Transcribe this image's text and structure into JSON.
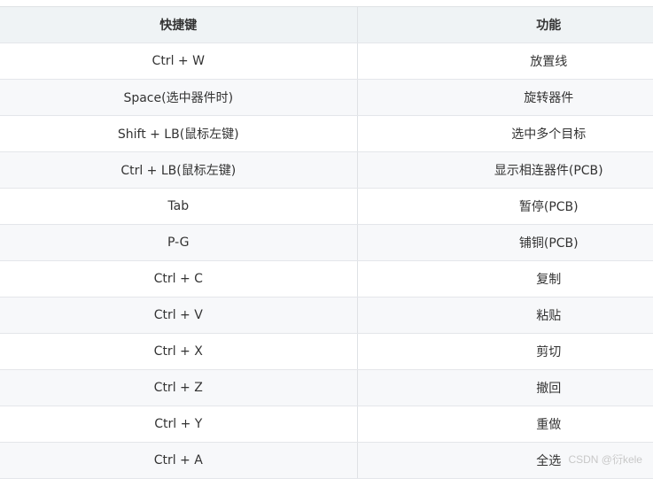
{
  "table": {
    "headers": [
      "快捷键",
      "功能"
    ],
    "rows": [
      [
        "Ctrl + W",
        "放置线"
      ],
      [
        "Space(选中器件时)",
        "旋转器件"
      ],
      [
        "Shift + LB(鼠标左键)",
        "选中多个目标"
      ],
      [
        "Ctrl + LB(鼠标左键)",
        "显示相连器件(PCB)"
      ],
      [
        "Tab",
        "暂停(PCB)"
      ],
      [
        "P-G",
        "铺铜(PCB)"
      ],
      [
        "Ctrl + C",
        "复制"
      ],
      [
        "Ctrl + V",
        "粘贴"
      ],
      [
        "Ctrl + X",
        "剪切"
      ],
      [
        "Ctrl + Z",
        "撤回"
      ],
      [
        "Ctrl + Y",
        "重做"
      ],
      [
        "Ctrl + A",
        "全选"
      ]
    ]
  },
  "watermark": "CSDN @衍kele"
}
